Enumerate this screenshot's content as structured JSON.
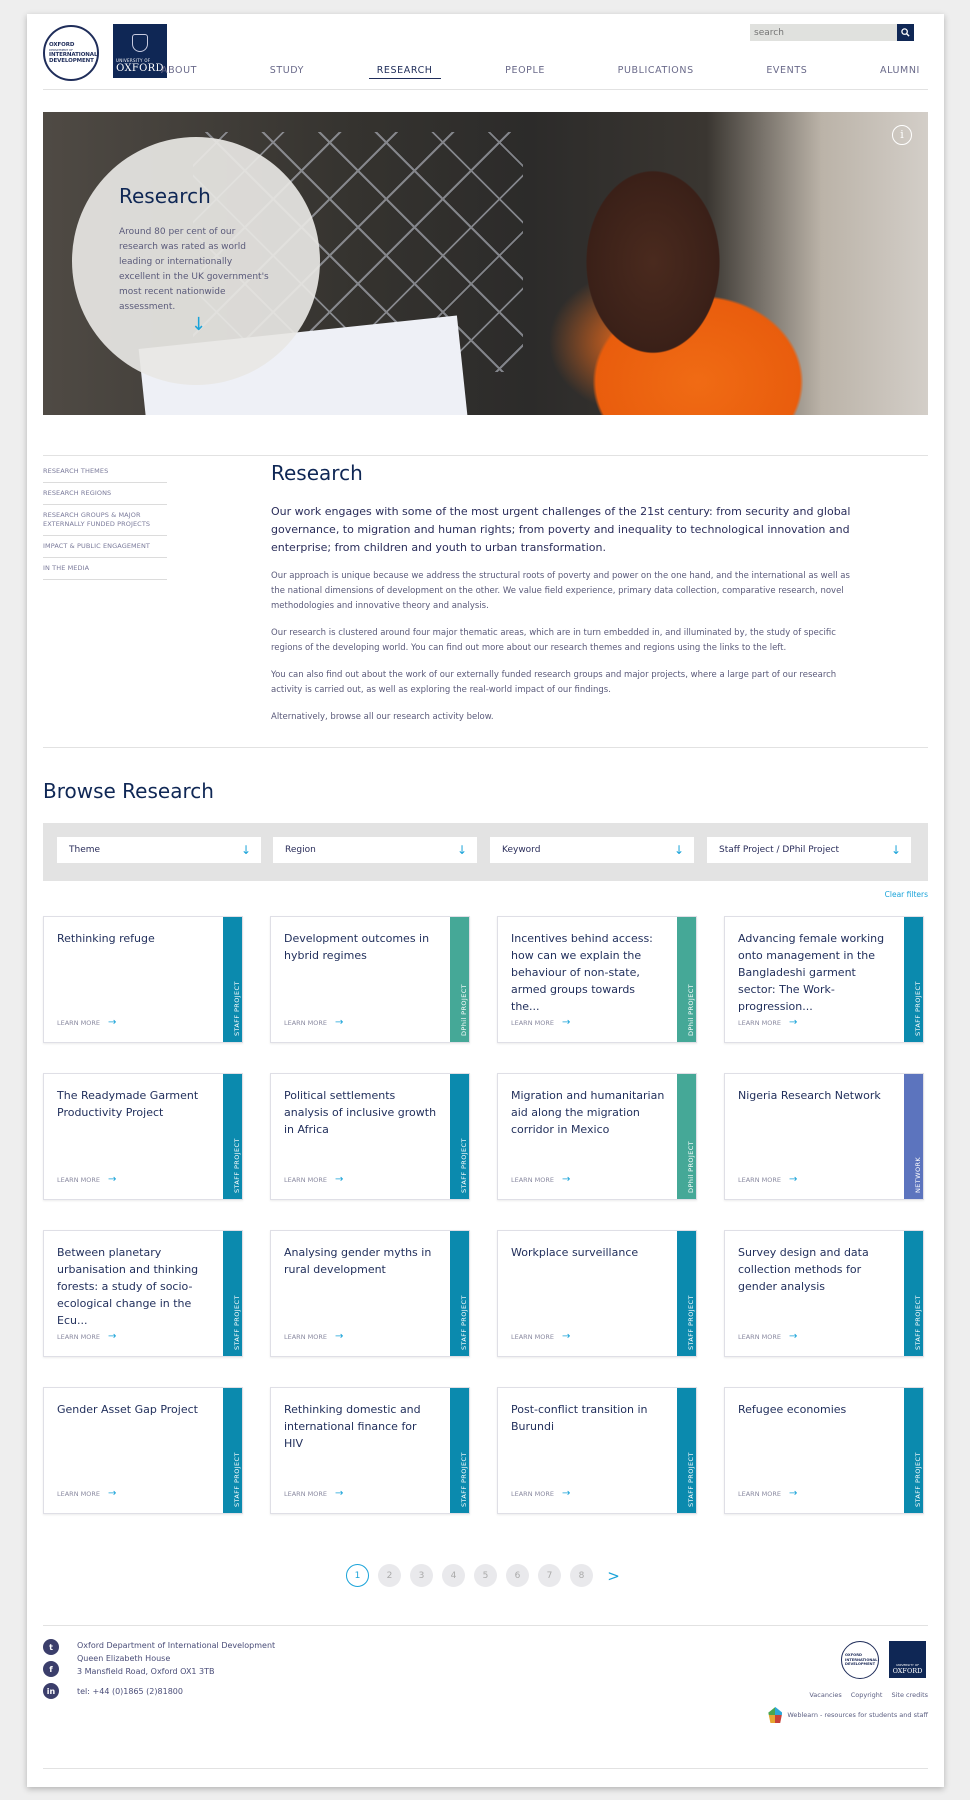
{
  "header": {
    "logo_idd": [
      "OXFORD",
      "DEPARTMENT OF",
      "INTERNATIONAL",
      "DEVELOPMENT"
    ],
    "logo_oxford": {
      "line1": "UNIVERSITY OF",
      "line2": "OXFORD"
    },
    "search_placeholder": "search",
    "search_icon": "search-icon",
    "nav": [
      {
        "label": "ABOUT",
        "active": false
      },
      {
        "label": "STUDY",
        "active": false
      },
      {
        "label": "RESEARCH",
        "active": true
      },
      {
        "label": "PEOPLE",
        "active": false
      },
      {
        "label": "PUBLICATIONS",
        "active": false
      },
      {
        "label": "EVENTS",
        "active": false
      },
      {
        "label": "ALUMNI",
        "active": false
      }
    ]
  },
  "hero": {
    "title": "Research",
    "text": "Around 80 per cent of our research was rated as world leading or internationally excellent in the UK government's most recent nationwide assessment.",
    "arrow_icon": "arrow-down-icon",
    "info_icon": "info-icon",
    "info_glyph": "i"
  },
  "sidenav": [
    "RESEARCH THEMES",
    "RESEARCH REGIONS",
    "RESEARCH GROUPS & MAJOR EXTERNALLY FUNDED PROJECTS",
    "IMPACT & PUBLIC ENGAGEMENT",
    "IN THE MEDIA"
  ],
  "main": {
    "title": "Research",
    "lead": "Our work engages with some of the most urgent challenges of the 21st century: from security and global governance, to migration and human rights; from poverty and inequality to technological innovation and enterprise; from children and youth to urban transformation.",
    "paragraphs": [
      "Our approach is unique because we address the structural roots of poverty and power on the one hand, and the international as well as the national dimensions of development on the other. We value field experience, primary data collection, comparative research, novel methodologies and innovative theory and analysis.",
      "Our research is clustered around four major thematic areas, which are in turn embedded in, and illuminated by, the study of specific regions of the developing world. You can find out more about our research themes and regions using the links to the left.",
      "You can also find out about the work of our externally funded research groups and major projects, where a large part of our research activity is carried out, as well as exploring the real-world impact of our findings.",
      "Alternatively, browse all our research activity below."
    ]
  },
  "browse": {
    "title": "Browse Research",
    "filters": [
      "Theme",
      "Region",
      "Keyword",
      "Staff Project / DPhil Project"
    ],
    "filter_arrow": "↓",
    "clear_filters": "Clear filters",
    "learn_more": "LEARN MORE",
    "tag_colors": {
      "STAFF PROJECT": "#0b8aae",
      "DPhil PROJECT": "#45a897",
      "NETWORK": "#5c74be"
    },
    "cards": [
      {
        "title": "Rethinking refuge",
        "tag": "STAFF PROJECT"
      },
      {
        "title": "Development outcomes in hybrid regimes",
        "tag": "DPhil PROJECT"
      },
      {
        "title": "Incentives behind access: how can we explain the behaviour of non-state, armed groups towards the...",
        "tag": "DPhil PROJECT"
      },
      {
        "title": "Advancing female working onto management in the Bangladeshi garment sector: The Work-progression...",
        "tag": "STAFF PROJECT"
      },
      {
        "title": "The Readymade Garment Productivity Project",
        "tag": "STAFF PROJECT"
      },
      {
        "title": "Political settlements analysis of inclusive growth in Africa",
        "tag": "STAFF PROJECT"
      },
      {
        "title": "Migration and humanitarian aid along the migration corridor in Mexico",
        "tag": "DPhil PROJECT"
      },
      {
        "title": "Nigeria Research Network",
        "tag": "NETWORK"
      },
      {
        "title": "Between planetary urbanisation and thinking forests: a study of socio-ecological change in the Ecu...",
        "tag": "STAFF PROJECT"
      },
      {
        "title": "Analysing gender myths in rural development",
        "tag": "STAFF PROJECT"
      },
      {
        "title": "Workplace surveillance",
        "tag": "STAFF PROJECT"
      },
      {
        "title": "Survey design and data collection methods for gender analysis",
        "tag": "STAFF PROJECT"
      },
      {
        "title": "Gender Asset Gap Project",
        "tag": "STAFF PROJECT"
      },
      {
        "title": "Rethinking domestic and international finance for HIV",
        "tag": "STAFF PROJECT"
      },
      {
        "title": "Post-conflict transition in Burundi",
        "tag": "STAFF PROJECT"
      },
      {
        "title": "Refugee economies",
        "tag": "STAFF PROJECT"
      }
    ]
  },
  "pagination": {
    "pages": [
      "1",
      "2",
      "3",
      "4",
      "5",
      "6",
      "7",
      "8"
    ],
    "current": "1",
    "next": ">"
  },
  "footer": {
    "social": [
      {
        "icon": "twitter-icon",
        "glyph": "t"
      },
      {
        "icon": "facebook-icon",
        "glyph": "f"
      },
      {
        "icon": "linkedin-icon",
        "glyph": "in"
      }
    ],
    "address": [
      "Oxford Department of International Development",
      "Queen Elizabeth House",
      "3 Mansfield Road, Oxford OX1 3TB"
    ],
    "tel": "tel: +44 (0)1865 (2)81800",
    "links": [
      "Vacancies",
      "Copyright",
      "Site credits"
    ],
    "weblearn": "Weblearn - resources for students and staff"
  }
}
